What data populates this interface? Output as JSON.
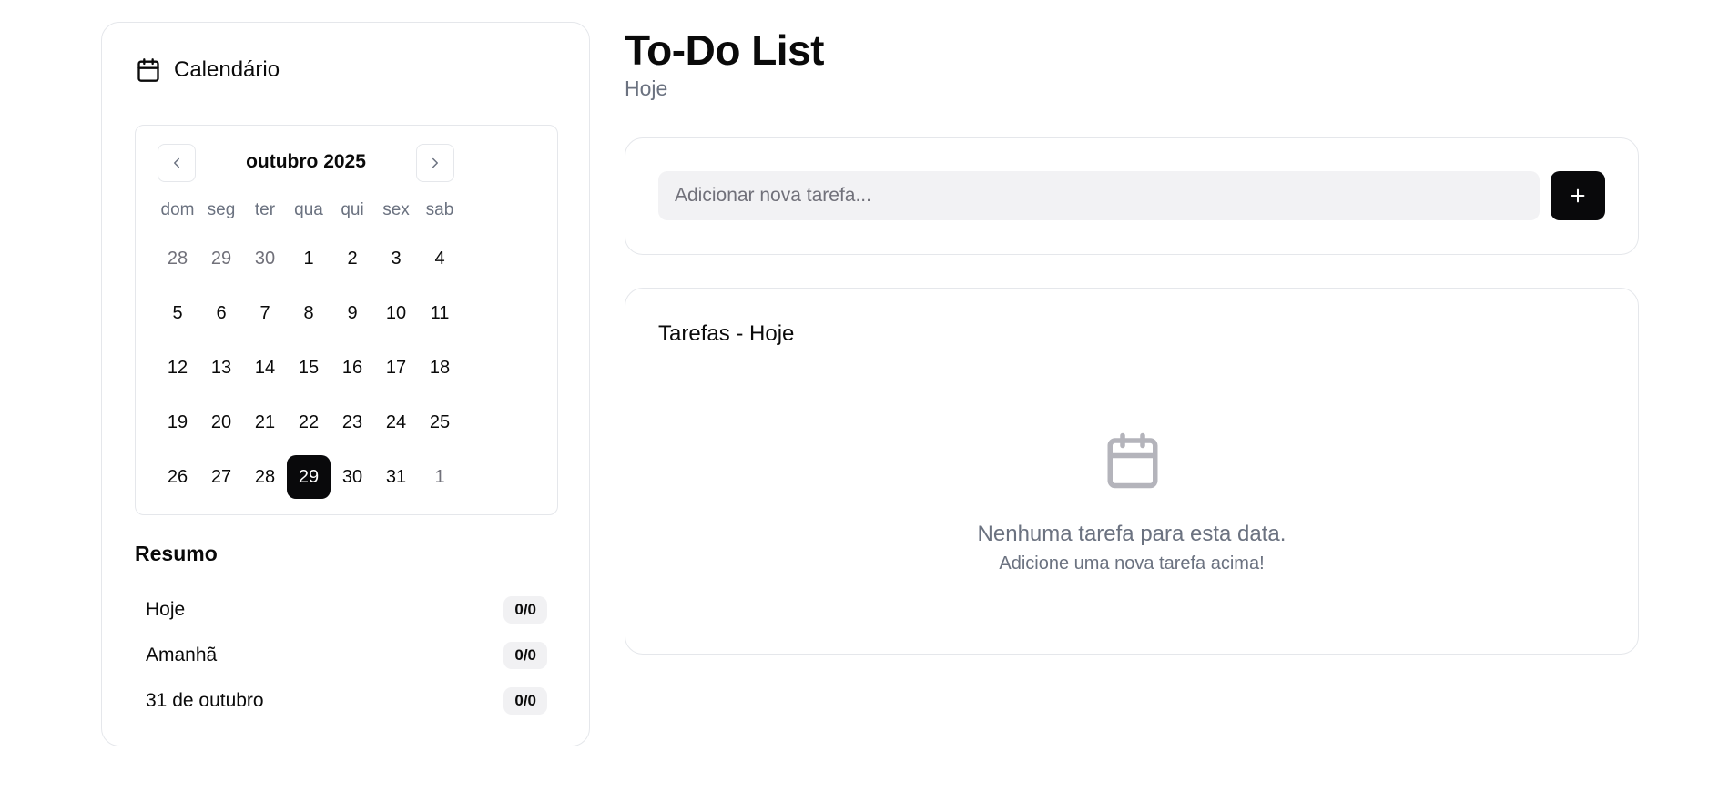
{
  "sidebar": {
    "calendar_title": "Calendário",
    "month_label": "outubro 2025",
    "weekdays": [
      "dom",
      "seg",
      "ter",
      "qua",
      "qui",
      "sex",
      "sab"
    ],
    "days": [
      {
        "d": "28",
        "muted": true
      },
      {
        "d": "29",
        "muted": true
      },
      {
        "d": "30",
        "muted": true
      },
      {
        "d": "1"
      },
      {
        "d": "2"
      },
      {
        "d": "3"
      },
      {
        "d": "4"
      },
      {
        "d": "5"
      },
      {
        "d": "6"
      },
      {
        "d": "7"
      },
      {
        "d": "8"
      },
      {
        "d": "9"
      },
      {
        "d": "10"
      },
      {
        "d": "11"
      },
      {
        "d": "12"
      },
      {
        "d": "13"
      },
      {
        "d": "14"
      },
      {
        "d": "15"
      },
      {
        "d": "16"
      },
      {
        "d": "17"
      },
      {
        "d": "18"
      },
      {
        "d": "19"
      },
      {
        "d": "20"
      },
      {
        "d": "21"
      },
      {
        "d": "22"
      },
      {
        "d": "23"
      },
      {
        "d": "24"
      },
      {
        "d": "25"
      },
      {
        "d": "26"
      },
      {
        "d": "27"
      },
      {
        "d": "28"
      },
      {
        "d": "29",
        "selected": true
      },
      {
        "d": "30"
      },
      {
        "d": "31"
      },
      {
        "d": "1",
        "muted": true
      }
    ],
    "summary_title": "Resumo",
    "summary": [
      {
        "label": "Hoje",
        "count": "0/0"
      },
      {
        "label": "Amanhã",
        "count": "0/0"
      },
      {
        "label": "31 de outubro",
        "count": "0/0"
      }
    ]
  },
  "main": {
    "title": "To-Do List",
    "subtitle": "Hoje",
    "input_placeholder": "Adicionar nova tarefa...",
    "tasks_title": "Tarefas - Hoje",
    "empty_primary": "Nenhuma tarefa para esta data.",
    "empty_secondary": "Adicione uma nova tarefa acima!"
  },
  "colors": {
    "accent": "#09090b",
    "muted_text": "#6b7280",
    "border": "#e5e7eb",
    "input_bg": "#f2f2f4"
  },
  "icons": {
    "calendar": "calendar-icon",
    "prev": "chevron-left-icon",
    "next": "chevron-right-icon",
    "add": "plus-icon",
    "empty": "calendar-icon"
  }
}
